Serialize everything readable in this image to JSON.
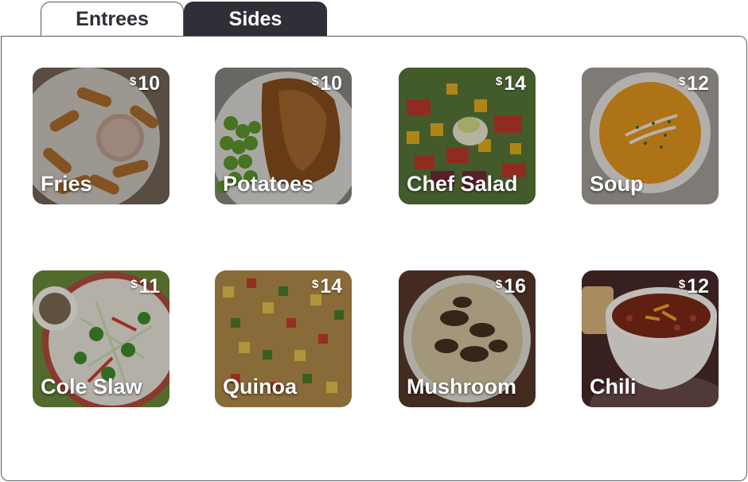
{
  "tabs": [
    {
      "label": "Entrees",
      "selected": false
    },
    {
      "label": "Sides",
      "selected": true
    }
  ],
  "currency_symbol": "$",
  "items": [
    {
      "name": "Fries",
      "price": "10"
    },
    {
      "name": "Potatoes",
      "price": "10"
    },
    {
      "name": "Chef Salad",
      "price": "14"
    },
    {
      "name": "Soup",
      "price": "12"
    },
    {
      "name": "Cole Slaw",
      "price": "11"
    },
    {
      "name": "Quinoa",
      "price": "14"
    },
    {
      "name": "Mushroom",
      "price": "16"
    },
    {
      "name": "Chili",
      "price": "12"
    }
  ],
  "colors": {
    "active_tab": "#2f2f38",
    "border": "#5a5a60",
    "text_dark": "#2e2e36"
  }
}
